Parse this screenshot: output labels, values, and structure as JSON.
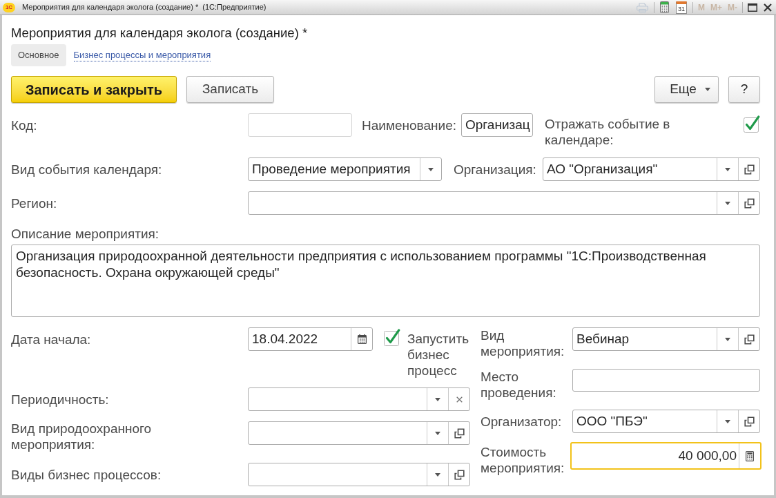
{
  "window": {
    "logo": "1С",
    "title": "Мероприятия для календаря эколога (создание) *  (1С:Предприятие)",
    "tools": [
      {
        "kind": "print",
        "disabled": true
      },
      {
        "kind": "calculator",
        "disabled": false
      },
      {
        "kind": "calendar",
        "label": "31",
        "disabled": false
      },
      {
        "kind": "memory",
        "label": "M",
        "disabled": true
      },
      {
        "kind": "memory",
        "label": "M+",
        "disabled": true
      },
      {
        "kind": "memory",
        "label": "M-",
        "disabled": true
      }
    ]
  },
  "form": {
    "title": "Мероприятия для календаря эколога (создание) *",
    "tabs": [
      {
        "label": "Основное",
        "selected": true
      },
      {
        "label": "Бизнес процессы и мероприятия",
        "selected": false
      }
    ],
    "commands": [
      {
        "label": "Записать и закрыть",
        "kind": "primary"
      },
      {
        "label": "Записать",
        "kind": "default"
      }
    ],
    "more_button": {
      "label": "Еще"
    },
    "help_button": {
      "label": "?"
    }
  },
  "fields": {
    "code": {
      "label": "Код:"
    },
    "name": {
      "label": "Наименование:",
      "value": "Организац"
    },
    "show_in_calendar": {
      "label": "Отражать событие в календаре:",
      "checked": true
    },
    "calendar_event_type": {
      "label": "Вид события календаря:",
      "value": "Проведение мероприятия"
    },
    "organization": {
      "label": "Организация:",
      "value": "АО \"Организация\""
    },
    "region": {
      "label": "Регион:"
    },
    "description": {
      "label": "Описание мероприятия:",
      "value": "Организация природоохранной деятельности предприятия с использованием программы \"1С:Производственная безопасность. Охрана окружающей среды\""
    },
    "start_date": {
      "label": "Дата начала:",
      "value": "18.04.2022"
    },
    "start_business_process": {
      "label": "Запустить бизнес процесс",
      "checked": true
    },
    "event_kind": {
      "label": "Вид мероприятия:",
      "value": "Вебинар"
    },
    "venue": {
      "label": "Место проведения:"
    },
    "periodicity": {
      "label": "Периодичность:"
    },
    "organizer": {
      "label": "Организатор:",
      "value": "ООО \"ПБЭ\""
    },
    "environmental_activity_kind": {
      "label": "Вид природоохранного мероприятия:"
    },
    "cost": {
      "label": "Стоимость мероприятия:",
      "value": "40 000,00",
      "focused": true
    },
    "business_process_kinds": {
      "label": "Виды бизнес процессов:"
    }
  }
}
